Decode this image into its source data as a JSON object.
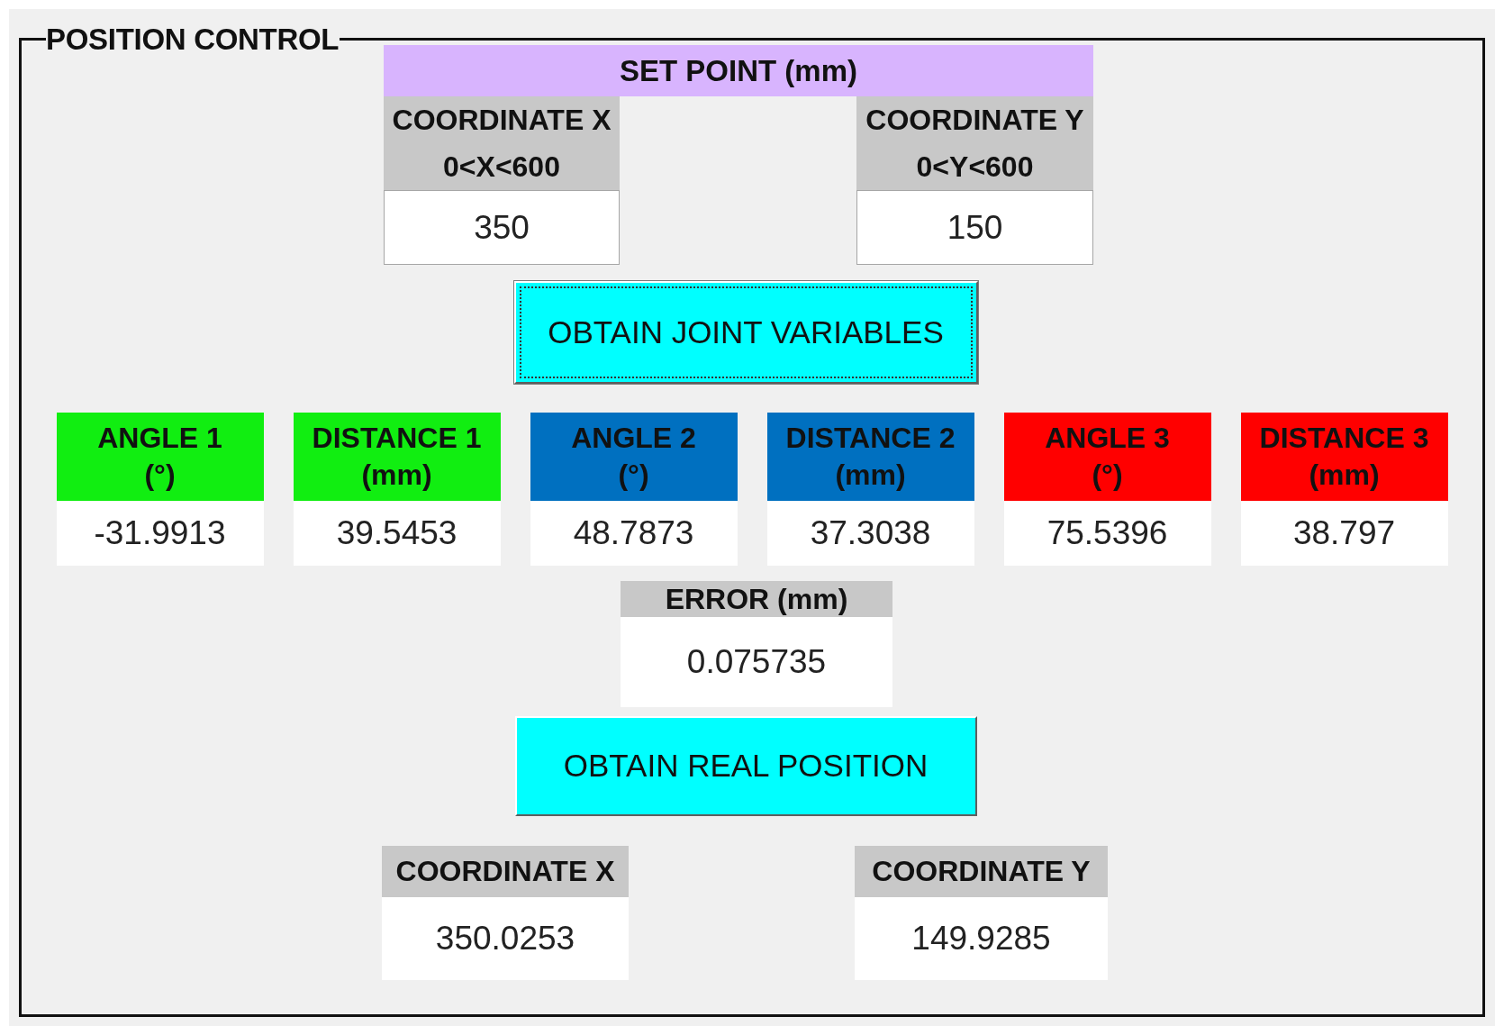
{
  "panel": {
    "title": "POSITION CONTROL"
  },
  "set_point": {
    "title": "SET POINT (mm)",
    "fields": [
      {
        "label": "COORDINATE X",
        "range": "0<X<600",
        "value": "350"
      },
      {
        "label": "COORDINATE Y",
        "range": "0<Y<600",
        "value": "150"
      }
    ]
  },
  "joint_button": {
    "label": "OBTAIN JOINT VARIABLES",
    "focused": true
  },
  "joint_variables": [
    {
      "label": "ANGLE 1",
      "unit": "(°)",
      "value": "-31.9913",
      "color": "#11ee11"
    },
    {
      "label": "DISTANCE 1",
      "unit": "(mm)",
      "value": "39.5453",
      "color": "#11ee11"
    },
    {
      "label": "ANGLE 2",
      "unit": "(°)",
      "value": "48.7873",
      "color": "#0070c0"
    },
    {
      "label": "DISTANCE 2",
      "unit": "(mm)",
      "value": "37.3038",
      "color": "#0070c0"
    },
    {
      "label": "ANGLE 3",
      "unit": "(°)",
      "value": "75.5396",
      "color": "#ff0000"
    },
    {
      "label": "DISTANCE 3",
      "unit": "(mm)",
      "value": "38.797",
      "color": "#ff0000"
    }
  ],
  "error": {
    "label": "ERROR (mm)",
    "value": "0.075735"
  },
  "position_button": {
    "label": "OBTAIN REAL POSITION",
    "focused": false
  },
  "real_position": [
    {
      "label": "COORDINATE X",
      "value": "350.0253"
    },
    {
      "label": "COORDINATE Y",
      "value": "149.9285"
    }
  ]
}
